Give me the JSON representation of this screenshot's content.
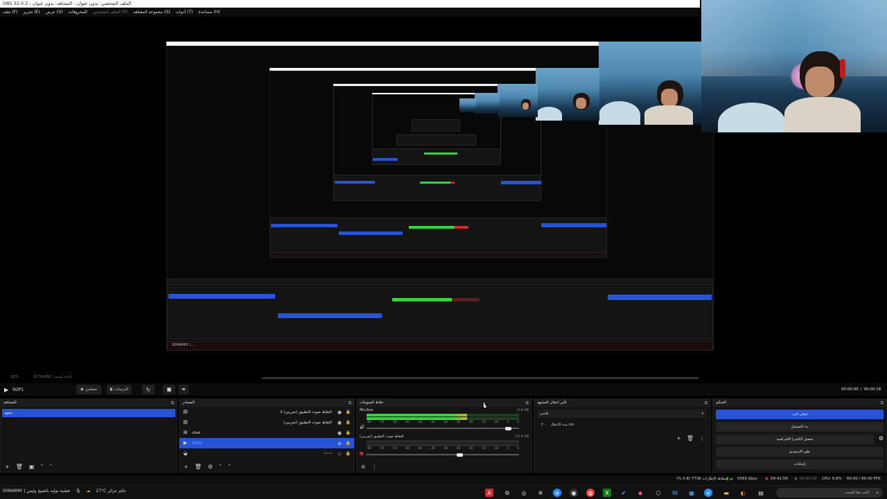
{
  "window": {
    "title": "OBS 32.0.2 - الملف الشخصي: بدون عنوان - المشاهد: بدون عنوان"
  },
  "menu": [
    {
      "label": "ملف (F)",
      "dim": false
    },
    {
      "label": "تحرير (E)",
      "dim": false
    },
    {
      "label": "عرض (V)",
      "dim": false
    },
    {
      "label": "المحروفات",
      "dim": false
    },
    {
      "label": "الملف الشخصي (P)",
      "dim": true
    },
    {
      "label": "مجموعة المشاهد (S)",
      "dim": false
    },
    {
      "label": "أدوات (T)",
      "dim": false
    },
    {
      "label": "مساعدة (H)",
      "dim": false
    }
  ],
  "preview": {
    "zoom_label": "82%",
    "resolution_label": "1579x888 / إعادة تسمية"
  },
  "controls": {
    "scene_name": "SOP1",
    "studio_label": "مصلتين",
    "transitions_label": "الترتيبات",
    "time_left": "00:00:00",
    "time_right": "00:00:18",
    "time_sep": "/"
  },
  "docks": {
    "scenes": {
      "title": "المشاهد",
      "items": [
        {
          "label": "مشهد",
          "selected": true
        }
      ]
    },
    "sources": {
      "title": "المصادر",
      "items": [
        {
          "name": "التقاط صوت التطبيق (تجريبي) 2",
          "type_icon": "window-capture-icon",
          "selected": false
        },
        {
          "name": "التقاط صوت التطبيق (تجريبي)",
          "type_icon": "window-capture-icon",
          "selected": false
        },
        {
          "name": "chat",
          "type_icon": "browser-source-icon",
          "selected": false
        },
        {
          "name": "SOP1",
          "type_icon": "video-capture-icon",
          "selected": true
        },
        {
          "name": "الحملة",
          "type_icon": "display-capture-icon",
          "selected": false
        }
      ]
    },
    "mixer": {
      "title": "خلاط الصوتيات",
      "tracks": [
        {
          "name": "Mic/Aux",
          "db": "-0.8 dB",
          "level": 0.66,
          "volume": 0.95
        },
        {
          "name": "التقاط صوت التطبيق (تجريبي)",
          "db": "-10.4 dB",
          "level": 0.0,
          "volume": 0.63
        }
      ],
      "ticks": [
        "-60",
        "-55",
        "-50",
        "-45",
        "-40",
        "-35",
        "-30",
        "-25",
        "-20",
        "-15",
        "-10",
        "-5",
        "0"
      ]
    },
    "transitions": {
      "title": "تأثير انتقال المشهد",
      "selected": "تلاشي",
      "duration_label": "مدة الانتقال",
      "duration_value": "٣٠٠ ms"
    },
    "controls": {
      "title": "التحكم",
      "buttons": [
        {
          "label": "ايقاف البث",
          "primary": true
        },
        {
          "label": "بدء التسجيل",
          "primary": false
        },
        {
          "label": "تشغيل الكاميرا الافتراضية",
          "primary": false
        },
        {
          "label": "طور الاستوديو",
          "primary": false
        },
        {
          "label": "إعدادات",
          "primary": false
        }
      ]
    }
  },
  "status": {
    "frames_dropped": "تم إسقاط الإطارات 7736 (0.8 %)",
    "bitrate": "5565 kbps",
    "stream_time": "04:41:59",
    "rec_time": "00:00:00",
    "cpu": "CPU: 0.8%",
    "fps": "60.00 / 60.00 FPS"
  },
  "taskbar": {
    "window_label": "00MARRY | فطنية توليه بالشيخ وليس",
    "weather": "27°C عالم جزائر",
    "search_placeholder": "اكتب هنا للبحث"
  },
  "colors": {
    "accent_blue": "#2753d6",
    "meter_green": "#37d23f",
    "meter_red": "#d02a2a",
    "dock_bg": "#141414"
  }
}
